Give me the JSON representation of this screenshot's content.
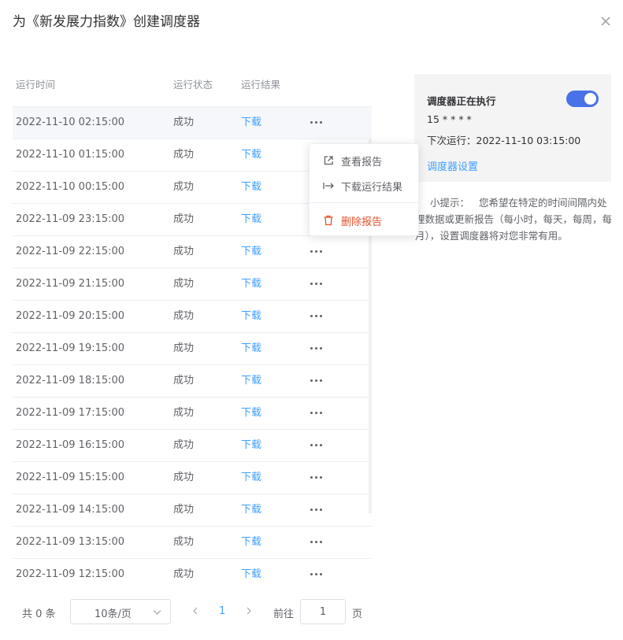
{
  "dialog": {
    "title": "为《新发展力指数》创建调度器"
  },
  "table": {
    "headers": {
      "time": "运行时间",
      "status": "运行状态",
      "result": "运行结果"
    },
    "rows": [
      {
        "time": "2022-11-10 02:15:00",
        "status": "成功",
        "result": "下载"
      },
      {
        "time": "2022-11-10 01:15:00",
        "status": "成功",
        "result": "下载"
      },
      {
        "time": "2022-11-10 00:15:00",
        "status": "成功",
        "result": "下载"
      },
      {
        "time": "2022-11-09 23:15:00",
        "status": "成功",
        "result": "下载"
      },
      {
        "time": "2022-11-09 22:15:00",
        "status": "成功",
        "result": "下载"
      },
      {
        "time": "2022-11-09 21:15:00",
        "status": "成功",
        "result": "下载"
      },
      {
        "time": "2022-11-09 20:15:00",
        "status": "成功",
        "result": "下载"
      },
      {
        "time": "2022-11-09 19:15:00",
        "status": "成功",
        "result": "下载"
      },
      {
        "time": "2022-11-09 18:15:00",
        "status": "成功",
        "result": "下载"
      },
      {
        "time": "2022-11-09 17:15:00",
        "status": "成功",
        "result": "下载"
      },
      {
        "time": "2022-11-09 16:15:00",
        "status": "成功",
        "result": "下载"
      },
      {
        "time": "2022-11-09 15:15:00",
        "status": "成功",
        "result": "下载"
      },
      {
        "time": "2022-11-09 14:15:00",
        "status": "成功",
        "result": "下载"
      },
      {
        "time": "2022-11-09 13:15:00",
        "status": "成功",
        "result": "下载"
      },
      {
        "time": "2022-11-09 12:15:00",
        "status": "成功",
        "result": "下载"
      }
    ]
  },
  "dropdown": {
    "view_report": "查看报告",
    "download_result": "下载运行结果",
    "delete_report": "删除报告"
  },
  "scheduler": {
    "title": "调度器正在执行",
    "enabled": true,
    "cron": "15 * * * *",
    "next_run": "下次运行：2022-11-10 03:15:00",
    "settings_link": "调度器设置"
  },
  "tip": {
    "label": "小提示：",
    "text": "您希望在特定的时间间隔内处理数据或更新报告（每小时，每天，每周，每月），设置调度器将对您非常有用。"
  },
  "pagination": {
    "total": "共 0 条",
    "page_size": "10条/页",
    "current_page": "1",
    "goto_label": "前往",
    "goto_value": "1",
    "page_unit": "页"
  },
  "colors": {
    "accent": "#409eff",
    "switch_on": "#4a72e8",
    "danger": "#e2532c"
  }
}
